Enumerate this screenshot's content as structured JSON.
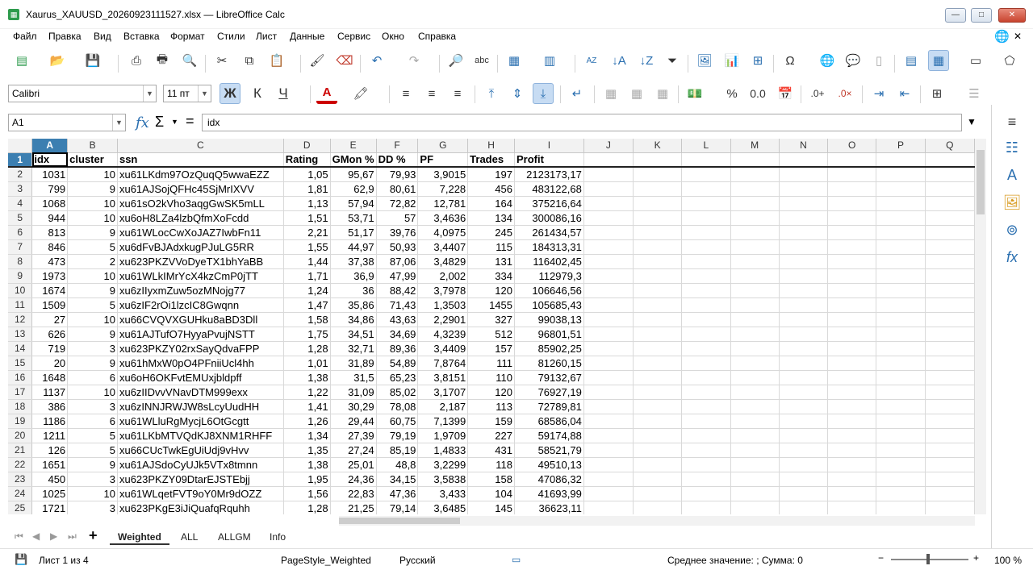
{
  "window": {
    "title": "Xaurus_XAUUSD_20260923111527.xlsx — LibreOffice Calc",
    "min": "—",
    "max": "□",
    "close": "✕"
  },
  "menu": [
    "Файл",
    "Правка",
    "Вид",
    "Вставка",
    "Формат",
    "Стили",
    "Лист",
    "Данные",
    "Сервис",
    "Окно",
    "Справка"
  ],
  "format_bar": {
    "font_name": "Calibri",
    "font_size": "11 пт",
    "bold": "Ж",
    "italic": "К",
    "underline": "Ч",
    "percent": "%",
    "decimal": "0.0"
  },
  "formula_bar": {
    "name_box": "A1",
    "fx": "fx",
    "sum": "Σ",
    "equals": "=",
    "content": "idx"
  },
  "columns": [
    "A",
    "B",
    "C",
    "D",
    "E",
    "F",
    "G",
    "H",
    "I",
    "J",
    "K",
    "L",
    "M",
    "N",
    "O",
    "P",
    "Q"
  ],
  "header_row": [
    "idx",
    "cluster",
    "ssn",
    "Rating",
    "GMon %",
    "DD %",
    "PF",
    "Trades",
    "Profit"
  ],
  "rows": [
    [
      "1031",
      "10",
      "xu61LKdm97OzQuqQ5wwaEZZ",
      "1,05",
      "95,67",
      "79,93",
      "3,9015",
      "197",
      "2123173,17"
    ],
    [
      "799",
      "9",
      "xu61AJSojQFHc45SjMrIXVV",
      "1,81",
      "62,9",
      "80,61",
      "7,228",
      "456",
      "483122,68"
    ],
    [
      "1068",
      "10",
      "xu61sO2kVho3aqgGwSK5mLL",
      "1,13",
      "57,94",
      "72,82",
      "12,781",
      "164",
      "375216,64"
    ],
    [
      "944",
      "10",
      "xu6oH8LZa4lzbQfmXoFcdd",
      "1,51",
      "53,71",
      "57",
      "3,4636",
      "134",
      "300086,16"
    ],
    [
      "813",
      "9",
      "xu61WLocCwXoJAZ7IwbFn11",
      "2,21",
      "51,17",
      "39,76",
      "4,0975",
      "245",
      "261434,57"
    ],
    [
      "846",
      "5",
      "xu6dFvBJAdxkugPJuLG5RR",
      "1,55",
      "44,97",
      "50,93",
      "3,4407",
      "115",
      "184313,31"
    ],
    [
      "473",
      "2",
      "xu623PKZVVoDyeTX1bhYaBB",
      "1,44",
      "37,38",
      "87,06",
      "3,4829",
      "131",
      "116402,45"
    ],
    [
      "1973",
      "10",
      "xu61WLkIMrYcX4kzCmP0jTT",
      "1,71",
      "36,9",
      "47,99",
      "2,002",
      "334",
      "112979,3"
    ],
    [
      "1674",
      "9",
      "xu6zIIyxmZuw5ozMNojg77",
      "1,24",
      "36",
      "88,42",
      "3,7978",
      "120",
      "106646,56"
    ],
    [
      "1509",
      "5",
      "xu6zIF2rOi1lzcIC8Gwqnn",
      "1,47",
      "35,86",
      "71,43",
      "1,3503",
      "1455",
      "105685,43"
    ],
    [
      "27",
      "10",
      "xu66CVQVXGUHku8aBD3Dll",
      "1,58",
      "34,86",
      "43,63",
      "2,2901",
      "327",
      "99038,13"
    ],
    [
      "626",
      "9",
      "xu61AJTufO7HyyaPvujNSTT",
      "1,75",
      "34,51",
      "34,69",
      "4,3239",
      "512",
      "96801,51"
    ],
    [
      "719",
      "3",
      "xu623PKZY02rxSayQdvaFPP",
      "1,28",
      "32,71",
      "89,36",
      "3,4409",
      "157",
      "85902,25"
    ],
    [
      "20",
      "9",
      "xu61hMxW0pO4PFniiUcl4hh",
      "1,01",
      "31,89",
      "54,89",
      "7,8764",
      "111",
      "81260,15"
    ],
    [
      "1648",
      "6",
      "xu6oH6OKFvtEMUxjbldpff",
      "1,38",
      "31,5",
      "65,23",
      "3,8151",
      "110",
      "79132,67"
    ],
    [
      "1137",
      "10",
      "xu6zIIDvvVNavDTM999exx",
      "1,22",
      "31,09",
      "85,02",
      "3,1707",
      "120",
      "76927,19"
    ],
    [
      "386",
      "3",
      "xu6zINNJRWJW8sLcyUudHH",
      "1,41",
      "30,29",
      "78,08",
      "2,187",
      "113",
      "72789,81"
    ],
    [
      "1186",
      "6",
      "xu61WLluRgMycjL6OtGcgtt",
      "1,26",
      "29,44",
      "60,75",
      "7,1399",
      "159",
      "68586,04"
    ],
    [
      "1211",
      "5",
      "xu61LKbMTVQdKJ8XNM1RHFF",
      "1,34",
      "27,39",
      "79,19",
      "1,9709",
      "227",
      "59174,88"
    ],
    [
      "126",
      "5",
      "xu66CUcTwkEgUiUdj9vHvv",
      "1,35",
      "27,24",
      "85,19",
      "1,4833",
      "431",
      "58521,79"
    ],
    [
      "1651",
      "9",
      "xu61AJSdoCyUJk5VTx8tmnn",
      "1,38",
      "25,01",
      "48,8",
      "3,2299",
      "118",
      "49510,13"
    ],
    [
      "450",
      "3",
      "xu623PKZY09DtarEJSTEbjj",
      "1,95",
      "24,36",
      "34,15",
      "3,5838",
      "158",
      "47086,32"
    ],
    [
      "1025",
      "10",
      "xu61WLqetFVT9oY0Mr9dOZZ",
      "1,56",
      "22,83",
      "47,36",
      "3,433",
      "104",
      "41693,99"
    ],
    [
      "1721",
      "3",
      "xu623PKgE3iJiQuafqRquhh",
      "1,28",
      "21,25",
      "79,14",
      "3,6485",
      "145",
      "36623,11"
    ]
  ],
  "sheet_tabs": [
    "Weighted",
    "ALL",
    "ALLGM",
    "Info"
  ],
  "status": {
    "sheet": "Лист 1 из 4",
    "page_style": "PageStyle_Weighted",
    "language": "Русский",
    "summary": "Среднее значение: ; Сумма: 0",
    "zoom": "100 %"
  }
}
